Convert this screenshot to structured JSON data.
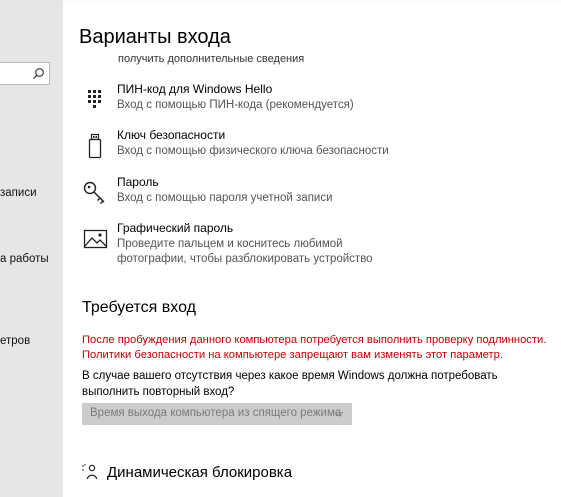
{
  "sidebar": {
    "items": [
      {
        "label": "записи"
      },
      {
        "label": "а работы"
      },
      {
        "label": "етров"
      }
    ]
  },
  "page": {
    "title": "Варианты входа",
    "more_info_link": "получить дополнительные сведения"
  },
  "options": [
    {
      "icon": "pin-keypad-icon",
      "title": "ПИН-код для Windows Hello",
      "desc": "Вход с помощью ПИН-кода (рекомендуется)"
    },
    {
      "icon": "usb-key-icon",
      "title": "Ключ безопасности",
      "desc": "Вход с помощью физического ключа безопасности"
    },
    {
      "icon": "key-icon",
      "title": "Пароль",
      "desc": "Вход с помощью пароля учетной записи"
    },
    {
      "icon": "picture-icon",
      "title": "Графический пароль",
      "desc": "Проведите пальцем и коснитесь любимой фотографии, чтобы разблокировать устройство"
    }
  ],
  "require_signin": {
    "heading": "Требуется вход",
    "warning_line1": "После пробуждения данного компьютера потребуется выполнить проверку подлинности.",
    "warning_line2": "Политики безопасности на компьютере запрещают вам изменять этот параметр.",
    "question": "В случае вашего отсутствия через какое время Windows должна потребовать выполнить повторный вход?",
    "dropdown_value": "Время выхода компьютера из спящего режима"
  },
  "dynamic_lock": {
    "icon": "dynamic-lock-icon",
    "heading": "Динамическая блокировка"
  },
  "colors": {
    "sidebar_bg": "#e6e6e6",
    "warning": "#c00000",
    "dropdown_bg": "#cccccc"
  }
}
